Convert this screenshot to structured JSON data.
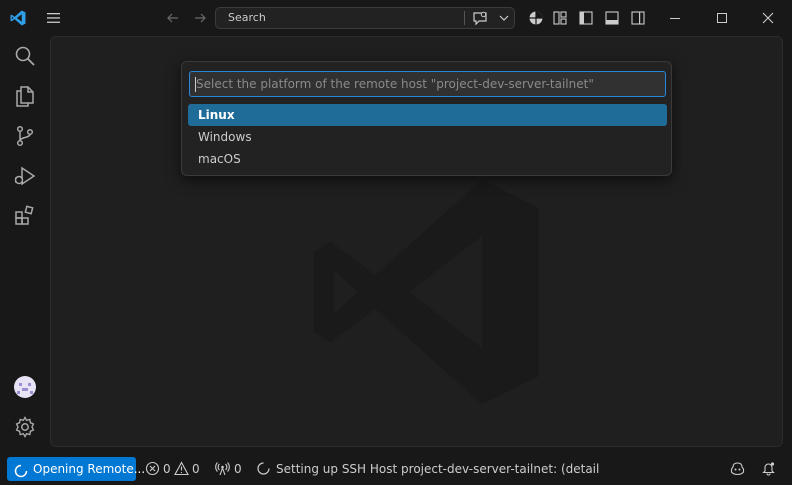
{
  "titlebar": {
    "search_label": "Search"
  },
  "quick_pick": {
    "placeholder": "Select the platform of the remote host \"project-dev-server-tailnet\"",
    "items": [
      {
        "label": "Linux",
        "selected": true
      },
      {
        "label": "Windows",
        "selected": false
      },
      {
        "label": "macOS",
        "selected": false
      }
    ]
  },
  "statusbar": {
    "remote_label": "Opening Remote...",
    "errors": "0",
    "warnings": "0",
    "ports": "0",
    "progress_message": "Setting up SSH Host project-dev-server-tailnet: (detail"
  },
  "colors": {
    "accent": "#0078d4",
    "selection": "#1f6c99",
    "background": "#181818",
    "editor": "#1f1f1f"
  }
}
